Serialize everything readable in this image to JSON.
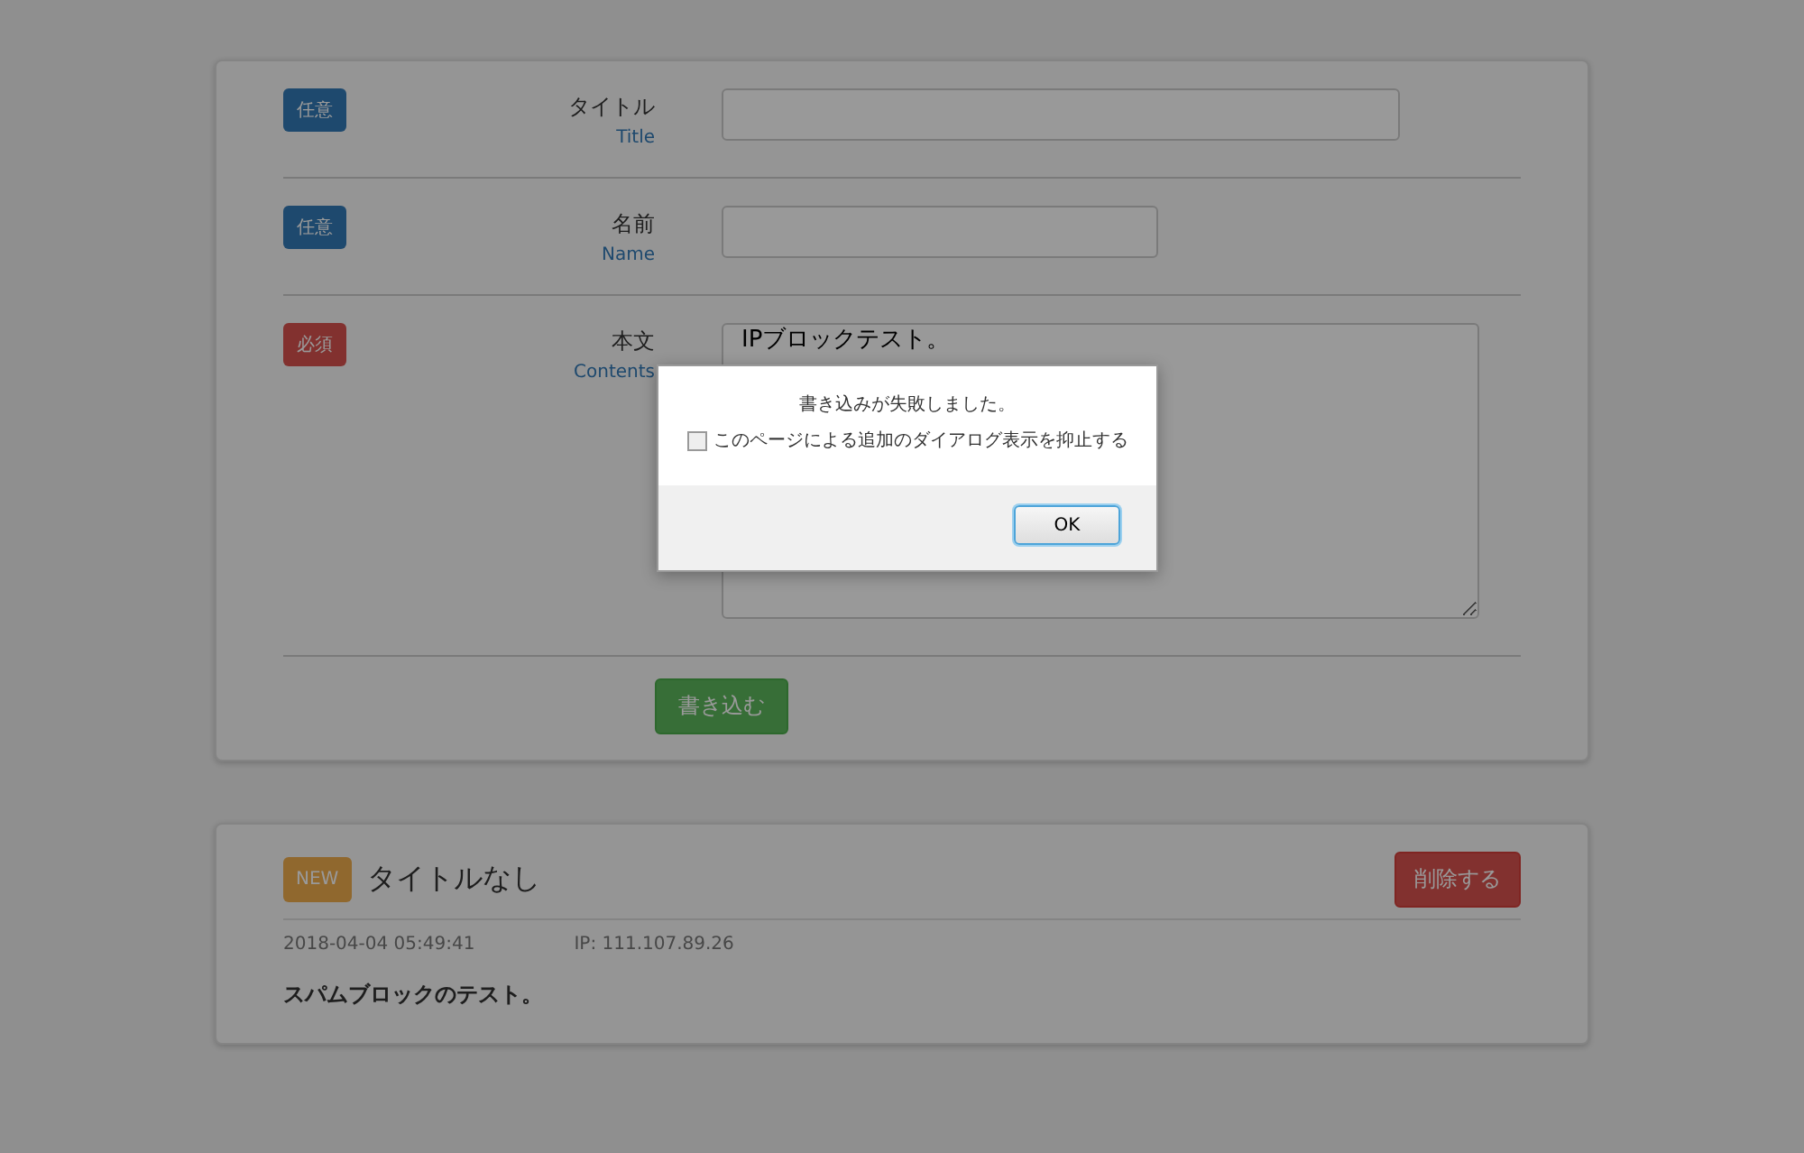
{
  "form": {
    "fields": [
      {
        "badge": {
          "text": "任意",
          "kind": "optional"
        },
        "label": "タイトル",
        "sublabel": "Title",
        "control": {
          "kind": "input"
        }
      },
      {
        "badge": {
          "text": "任意",
          "kind": "optional"
        },
        "label": "名前",
        "sublabel": "Name",
        "control": {
          "kind": "input"
        }
      },
      {
        "badge": {
          "text": "必須",
          "kind": "required"
        },
        "label": "本文",
        "sublabel": "Contents",
        "control": {
          "kind": "textarea",
          "value": "IPブロックテスト。"
        }
      }
    ],
    "submit": "書き込む"
  },
  "post": {
    "badge": "NEW",
    "title": "タイトルなし",
    "delete": "削除する",
    "date": "2018-04-04 05:49:41",
    "ip": "IP: 111.107.89.26",
    "body": "スパムブロックのテスト。"
  },
  "dialog": {
    "message": "書き込みが失敗しました。",
    "checkbox": {
      "label": "このページによる追加のダイアログ表示を抑止する",
      "checked": false
    },
    "ok": "OK"
  }
}
